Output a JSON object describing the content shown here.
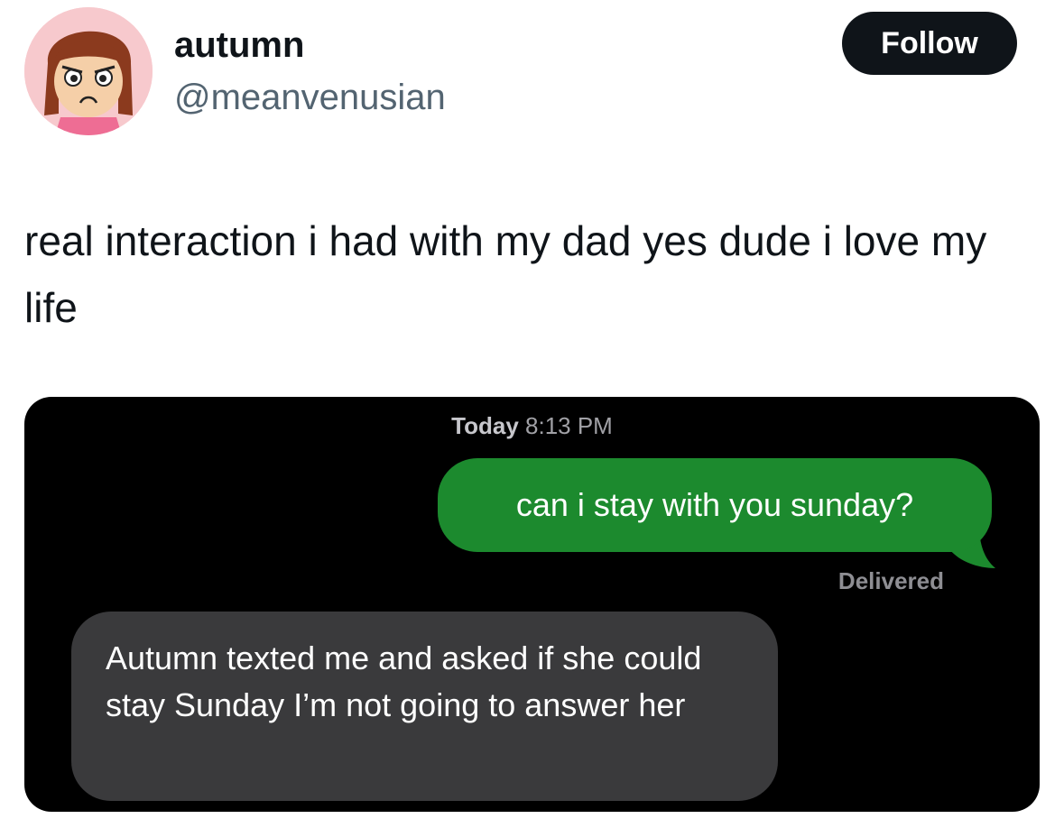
{
  "author": {
    "display_name": "autumn",
    "handle": "@meanvenusian",
    "avatar_icon": "cartoon-girl-avatar"
  },
  "follow_label": "Follow",
  "tweet": {
    "text": "real interaction i had with my dad yes dude i love my life"
  },
  "chat": {
    "day_label": "Today",
    "time_label": "8:13 PM",
    "sent_message": "can i stay with you sunday?",
    "status": "Delivered",
    "received_message": "Autumn texted me and asked if she could stay Sunday I’m not going to answer her"
  },
  "colors": {
    "sent_bubble": "#1c8a2e",
    "received_bubble": "#3a3a3c",
    "follow_button": "#0f1419"
  }
}
